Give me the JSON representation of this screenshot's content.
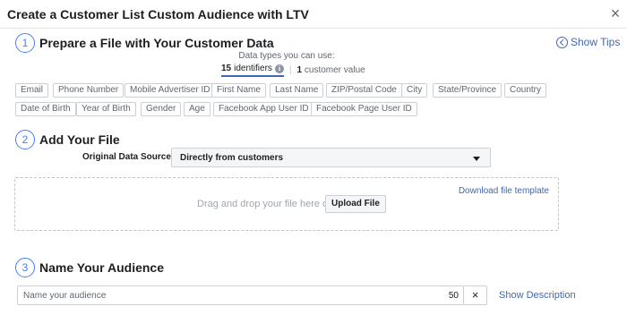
{
  "header": {
    "title": "Create a Customer List Custom Audience with LTV",
    "close_icon": "×"
  },
  "step1": {
    "number": "1",
    "title": "Prepare a File with Your Customer Data",
    "show_tips": "Show Tips",
    "data_types_label": "Data types you can use:",
    "identifiers_count": "15",
    "identifiers_label": "identifiers",
    "customer_value_count": "1",
    "customer_value_label": "customer value",
    "info_glyph": "i",
    "separator": "|",
    "identifiers": [
      "Email",
      "Phone Number",
      "Mobile Advertiser ID",
      "First Name",
      "Last Name",
      "ZIP/Postal Code",
      "City",
      "State/Province",
      "Country",
      "Date of Birth",
      "Year of Birth",
      "Gender",
      "Age",
      "Facebook App User ID",
      "Facebook Page User ID"
    ]
  },
  "step2": {
    "number": "2",
    "title": "Add Your File",
    "source_label": "Original Data Source",
    "source_value": "Directly from customers",
    "download_template": "Download file template",
    "drag_text": "Drag and drop your file here or",
    "upload_button": "Upload File"
  },
  "step3": {
    "number": "3",
    "title": "Name Your Audience",
    "input_placeholder": "Name your audience",
    "char_limit": "50",
    "clear_icon": "×",
    "show_description": "Show Description"
  },
  "colors": {
    "accent": "#4267b2",
    "step_circle": "#4080ff",
    "text": "#1c1e21",
    "muted": "#606770"
  }
}
